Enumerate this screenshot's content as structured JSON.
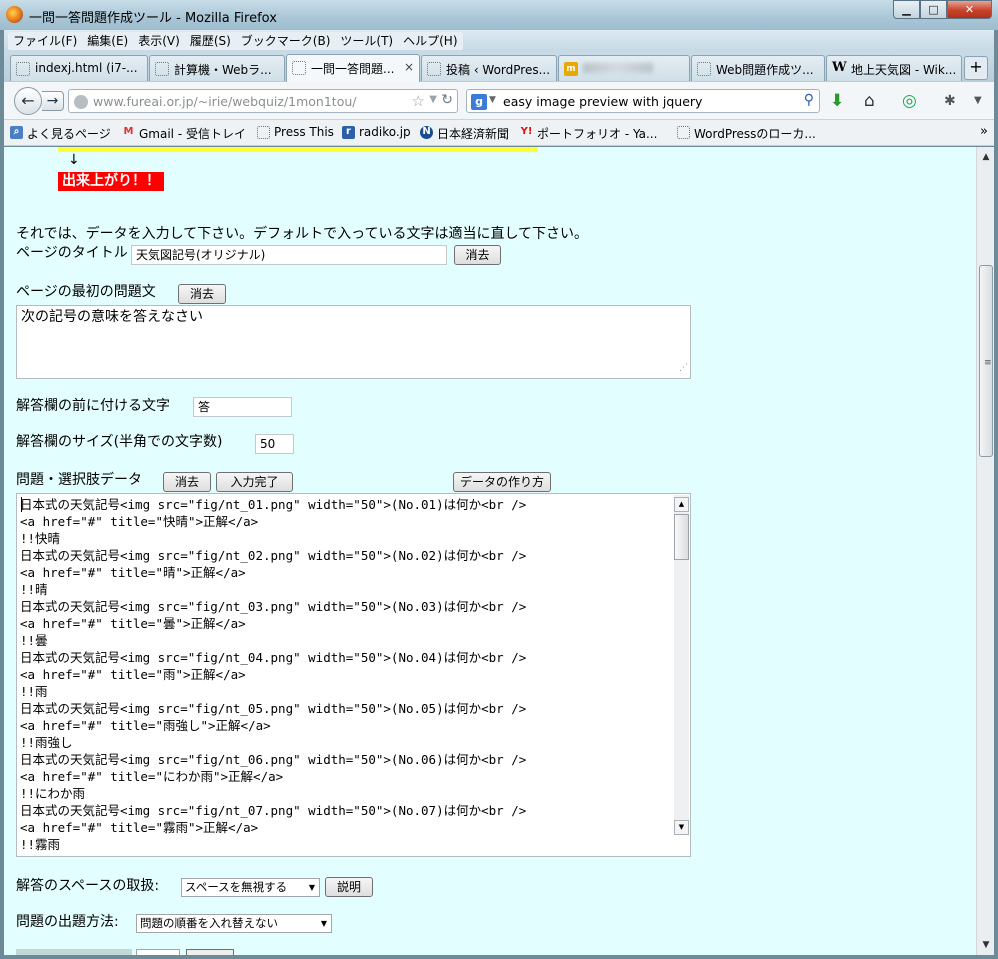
{
  "window": {
    "title": "一問一答問題作成ツール - Mozilla Firefox"
  },
  "menubar": [
    "ファイル(F)",
    "編集(E)",
    "表示(V)",
    "履歴(S)",
    "ブックマーク(B)",
    "ツール(T)",
    "ヘルプ(H)"
  ],
  "tabs": [
    {
      "label": "indexj.html (i7-...",
      "icon": "page-icon"
    },
    {
      "label": "計算機・Webラ...",
      "icon": "page-icon"
    },
    {
      "label": "一問一答問題...",
      "icon": "page-icon",
      "close": "×"
    },
    {
      "label": "投稿 ‹ WordPres...",
      "icon": "page-icon"
    },
    {
      "label": "",
      "icon": "site-icon"
    },
    {
      "label": "Web問題作成ツ...",
      "icon": "page-icon"
    },
    {
      "label": "地上天気図 - Wik...",
      "icon": "wikipedia-icon"
    }
  ],
  "nav": {
    "url_host": "www.fureai.or.jp",
    "url_path": "/~irie/webquiz/1mon1tou/",
    "search_query": "easy image preview with jquery"
  },
  "bookmarks": [
    {
      "label": "よく見るページ",
      "icon": "folder-icon"
    },
    {
      "label": "Gmail - 受信トレイ",
      "icon": "gmail-icon"
    },
    {
      "label": "Press This",
      "icon": "page-icon"
    },
    {
      "label": "radiko.jp",
      "icon": "radiko-icon"
    },
    {
      "label": "日本経済新聞",
      "icon": "nikkei-icon"
    },
    {
      "label": "ポートフォリオ - Ya...",
      "icon": "yahoo-icon"
    },
    {
      "label": "WordPressのローカ...",
      "icon": "page-icon"
    }
  ],
  "page": {
    "arrow": "↓",
    "done_label": "出来上がり！！",
    "intro": "それでは、データを入力して下さい。デフォルトで入っている文字は適当に直して下さい。",
    "title_label": "ページのタイトル",
    "title_value": "天気図記号(オリジナル)",
    "clear": "消去",
    "first_q_label": "ページの最初の問題文",
    "first_q_value": "次の記号の意味を答えなさい",
    "prefix_label": "解答欄の前に付ける文字",
    "prefix_value": "答",
    "size_label": "解答欄のサイズ(半角での文字数)",
    "size_value": "50",
    "data_label": "問題・選択肢データ",
    "input_done": "入力完了",
    "how_to": "データの作り方",
    "data_lines": [
      "日本式の天気記号<img src=\"fig/nt_01.png\" width=\"50\">(No.01)は何か<br />",
      "<a href=\"#\" title=\"快晴\">正解</a>",
      "!!快晴",
      "日本式の天気記号<img src=\"fig/nt_02.png\" width=\"50\">(No.02)は何か<br />",
      "<a href=\"#\" title=\"晴\">正解</a>",
      "!!晴",
      "日本式の天気記号<img src=\"fig/nt_03.png\" width=\"50\">(No.03)は何か<br />",
      "<a href=\"#\" title=\"曇\">正解</a>",
      "!!曇",
      "日本式の天気記号<img src=\"fig/nt_04.png\" width=\"50\">(No.04)は何か<br />",
      "<a href=\"#\" title=\"雨\">正解</a>",
      "!!雨",
      "日本式の天気記号<img src=\"fig/nt_05.png\" width=\"50\">(No.05)は何か<br />",
      "<a href=\"#\" title=\"雨強し\">正解</a>",
      "!!雨強し",
      "日本式の天気記号<img src=\"fig/nt_06.png\" width=\"50\">(No.06)は何か<br />",
      "<a href=\"#\" title=\"にわか雨\">正解</a>",
      "!!にわか雨",
      "日本式の天気記号<img src=\"fig/nt_07.png\" width=\"50\">(No.07)は何か<br />",
      "<a href=\"#\" title=\"霧雨\">正解</a>",
      "!!霧雨"
    ],
    "space_label": "解答のスペースの取扱:",
    "space_option": "スペースを無視する",
    "explain": "説明",
    "order_label": "問題の出題方法:",
    "order_option": "問題の順番を入れ替えない"
  },
  "colors": {
    "page_bg": "#e2fefe",
    "done_bg": "#ff0000",
    "highlight": "#ffff33"
  }
}
